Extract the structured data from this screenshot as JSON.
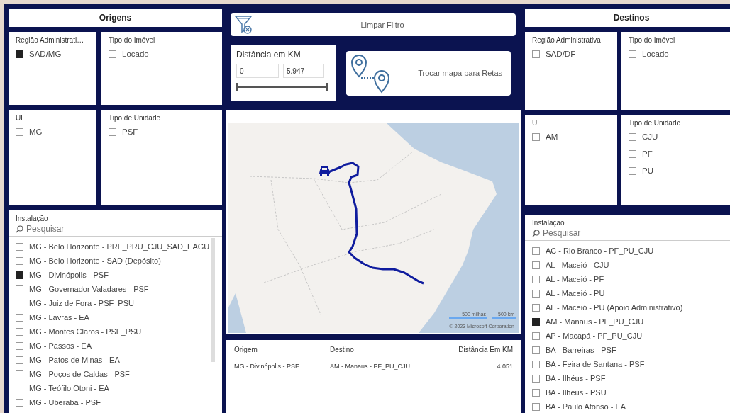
{
  "origens": {
    "title": "Origens",
    "slicers": [
      {
        "title": "Região Administrati…",
        "items": [
          {
            "label": "SAD/MG",
            "checked": true
          }
        ]
      },
      {
        "title": "Tipo do Imóvel",
        "items": [
          {
            "label": "Locado",
            "checked": false
          }
        ]
      },
      {
        "title": "UF",
        "items": [
          {
            "label": "MG",
            "checked": false
          }
        ]
      },
      {
        "title": "Tipo de Unidade",
        "items": [
          {
            "label": "PSF",
            "checked": false
          }
        ]
      }
    ],
    "instalacao": {
      "title": "Instalação",
      "search": {
        "placeholder": "Pesquisar"
      },
      "items": [
        {
          "label": "MG - Belo Horizonte - PRF_PRU_CJU_SAD_EAGU",
          "checked": false
        },
        {
          "label": "MG - Belo Horizonte - SAD (Depósito)",
          "checked": false
        },
        {
          "label": "MG - Divinópolis - PSF",
          "checked": true
        },
        {
          "label": "MG - Governador Valadares - PSF",
          "checked": false
        },
        {
          "label": "MG - Juiz de Fora - PSF_PSU",
          "checked": false
        },
        {
          "label": "MG - Lavras - EA",
          "checked": false
        },
        {
          "label": "MG - Montes Claros - PSF_PSU",
          "checked": false
        },
        {
          "label": "MG - Passos - EA",
          "checked": false
        },
        {
          "label": "MG - Patos de Minas - EA",
          "checked": false
        },
        {
          "label": "MG - Poços de Caldas - PSF",
          "checked": false
        },
        {
          "label": "MG - Teófilo Otoni - EA",
          "checked": false
        },
        {
          "label": "MG - Uberaba - PSF",
          "checked": false
        }
      ]
    }
  },
  "center": {
    "clear_filter": {
      "label": "Limpar Filtro"
    },
    "distance": {
      "title": "Distância em KM",
      "min": "0",
      "max": "5.947",
      "handles": [
        {
          "level": 0
        },
        {
          "level": 1
        }
      ]
    },
    "switch_map": {
      "label": "Trocar mapa para Retas"
    },
    "map": {
      "scale": [
        "500 milhas",
        "500 km"
      ],
      "copyright": "© 2023 Microsoft Corporation"
    },
    "table": {
      "columns": [
        "Origem",
        "Destino",
        "Distância Em KM"
      ],
      "rows": [
        [
          "MG - Divinópolis - PSF",
          "AM - Manaus - PF_PU_CJU",
          "4.051"
        ]
      ]
    }
  },
  "destinos": {
    "title": "Destinos",
    "slicers": [
      {
        "title": "Região Administrativa",
        "items": [
          {
            "label": "SAD/DF",
            "checked": false
          }
        ]
      },
      {
        "title": "Tipo do Imóvel",
        "items": [
          {
            "label": "Locado",
            "checked": false
          }
        ]
      },
      {
        "title": "UF",
        "items": [
          {
            "label": "AM",
            "checked": false
          }
        ]
      },
      {
        "title": "Tipo de Unidade",
        "items": [
          {
            "label": "CJU",
            "checked": false
          },
          {
            "label": "PF",
            "checked": false
          },
          {
            "label": "PU",
            "checked": false
          }
        ]
      }
    ],
    "instalacao": {
      "title": "Instalação",
      "search": {
        "placeholder": "Pesquisar"
      },
      "items": [
        {
          "label": "AC - Rio Branco - PF_PU_CJU",
          "checked": false
        },
        {
          "label": "AL - Maceió - CJU",
          "checked": false
        },
        {
          "label": "AL - Maceió - PF",
          "checked": false
        },
        {
          "label": "AL - Maceió - PU",
          "checked": false
        },
        {
          "label": "AL - Maceió - PU (Apoio Administrativo)",
          "checked": false
        },
        {
          "label": "AM - Manaus - PF_PU_CJU",
          "checked": true
        },
        {
          "label": "AP - Macapá - PF_PU_CJU",
          "checked": false
        },
        {
          "label": "BA - Barreiras - PSF",
          "checked": false
        },
        {
          "label": "BA - Feira de Santana - PSF",
          "checked": false
        },
        {
          "label": "BA - Ilhéus - PSF",
          "checked": false
        },
        {
          "label": "BA - Ilhéus - PSU",
          "checked": false
        },
        {
          "label": "BA - Paulo Afonso - EA",
          "checked": false
        }
      ]
    }
  }
}
